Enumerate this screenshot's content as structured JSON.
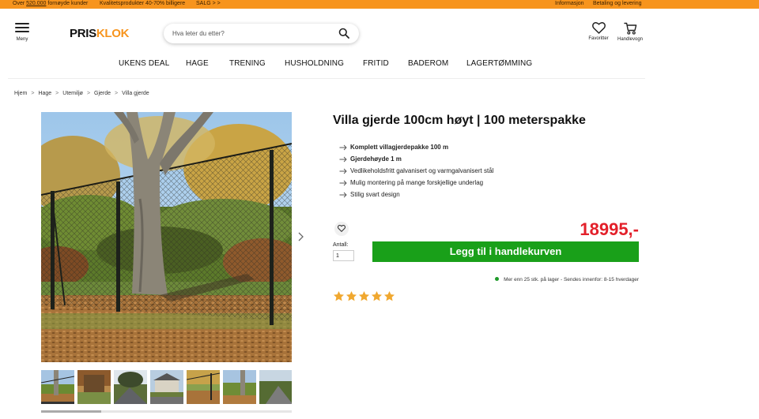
{
  "topbar": {
    "customers_prefix": "Over",
    "customers_count": "520.000",
    "customers_suffix": "fornøyde kunder",
    "quality": "Kvalitetsprodukter 40-70% billigere",
    "sale": "SALG > >",
    "info": "Informasjon",
    "payment": "Betaling og levering",
    "color": "#f7941d"
  },
  "header": {
    "menu_label": "Meny",
    "logo_part1": "PRIS",
    "logo_part2": "KLOK",
    "search_placeholder": "Hva leter du etter?",
    "favorites_label": "Favoritter",
    "cart_label": "Handlevogn"
  },
  "nav": {
    "items": [
      "UKENS DEAL",
      "HAGE",
      "TRENING",
      "HUSHOLDNING",
      "FRITID",
      "BADEROM",
      "LAGERTØMMING"
    ],
    "active": "HAGE"
  },
  "breadcrumb": [
    "Hjem",
    "Hage",
    "Utemiljø",
    "Gjerde",
    "Villa gjerde"
  ],
  "breadcrumb_separator": ">",
  "product": {
    "title": "Villa gjerde 100cm høyt | 100 meterspakke",
    "features": [
      {
        "text": "Komplett villagjerdepakke 100 m",
        "bold": true
      },
      {
        "text": "Gjerdehøyde 1 m",
        "bold": true
      },
      {
        "text": "Vedlikeholdsfritt galvanisert og varmgalvanisert stål",
        "bold": false
      },
      {
        "text": "Mulig montering på mange forskjellige underlag",
        "bold": false
      },
      {
        "text": "Stilig svart design",
        "bold": false
      }
    ],
    "price": "18995,-",
    "price_color": "#e3202a",
    "quantity_label": "Antall:",
    "quantity_value": "1",
    "add_to_cart": "Legg til i handlekurven",
    "cart_button_color": "#19a019",
    "stock_text": "Mer enn 25 stk. på lager - Sendes innenfor: 8-15 hverdager",
    "rating_stars": 5,
    "rating_max": 5,
    "star_color": "#f0a830"
  },
  "gallery": {
    "thumbnail_count": 7,
    "selected_thumbnail": 1,
    "scroll_fraction": 0.24,
    "icons": [
      "chevron-right-icon"
    ]
  }
}
